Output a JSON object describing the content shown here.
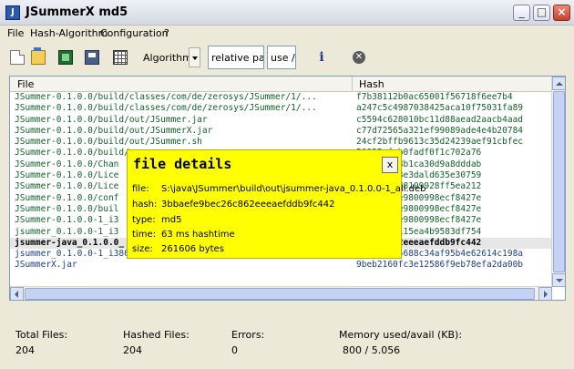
{
  "window": {
    "title": "JSummerX md5",
    "icon_letter": "J"
  },
  "menu": [
    "File",
    "Hash-Algorithm",
    "Configuration",
    "?"
  ],
  "toolbar": {
    "algorithm_label": "Algorithm",
    "path_field": "relative path",
    "use_field": "use /"
  },
  "table": {
    "headers": {
      "file": "File",
      "hash": "Hash"
    },
    "rows": [
      {
        "file": "JSummer-0.1.0.0/build/classes/com/de/zerosys/JSummer/1/...",
        "hash": "f7b38112b0ac65001f56718f6ee7b4"
      },
      {
        "file": "JSummer-0.1.0.0/build/classes/com/de/zerosys/JSummer/1/...",
        "hash": "a247c5c4987038425aca10f75031fa89"
      },
      {
        "file": "JSummer-0.1.0.0/build/out/JSummer.jar",
        "hash": "c5594c628010bc11d88aead2aacb4aad"
      },
      {
        "file": "JSummer-0.1.0.0/build/out/JSummerX.jar",
        "hash": "c77d72565a321ef99089ade4e4b20784"
      },
      {
        "file": "JSummer-0.1.0.0/build/out/JSummer.sh",
        "hash": "24cf2bffb9613c35d24239aef91cbfec"
      },
      {
        "file": "JSummer-0.1.0.0/build/",
        "hash": "50925efcb0fadf0f1c702a76"
      },
      {
        "file": "JSummer-0.1.0.0/Chan",
        "hash": "08f358518b1ca30d9a8dddab"
      },
      {
        "file": "JSummer-0.1.0.0/Lice",
        "hash": "747ac1508e3dald635e30759"
      },
      {
        "file": "JSummer-0.1.0.0/Lice",
        "hash": "824632e678109928ff5ea212"
      },
      {
        "file": "JSummer-0.1.0.0/conf",
        "hash": "8f00b204e9800998ecf8427e"
      },
      {
        "file": "JSummer-0.1.0.0/buil",
        "hash": "8f00b204e9800998ecf8427e"
      },
      {
        "file": "JSummer-0.1.0.0-1_i3",
        "hash": "8f00b204e9800998ecf8427e"
      },
      {
        "file": "jsummer_0.1.0.0-1_i3",
        "hash": "908f4224115ea4b9583df754"
      },
      {
        "file": "jsummer-java_0.1.0.0_",
        "hash": "bec26c862eeeaefddb9fc442"
      },
      {
        "file": "jsummer_0.1.0.0-1_i386.changes",
        "hash": "bcfdd9645688c34af95b4e62614c198a"
      },
      {
        "file": "JSummerX.jar",
        "hash": "9beb2160fc3e12586f9eb78efa2da00b"
      }
    ]
  },
  "popup": {
    "title": "file details",
    "close": "x",
    "rows": [
      {
        "label": "file:",
        "value": "S:\\java\\JSummer\\build\\out\\jsummer-java_0.1.0.0-1_all.deb"
      },
      {
        "label": "hash:",
        "value": "3bbaefe9bec26c862eeeaefddb9fc442"
      },
      {
        "label": "type:",
        "value": "md5"
      },
      {
        "label": "time:",
        "value": "63 ms hashtime"
      },
      {
        "label": "size:",
        "value": "261606 bytes"
      }
    ]
  },
  "status": {
    "total_label": "Total Files:",
    "total_value": "204",
    "hashed_label": "Hashed Files:",
    "hashed_value": "204",
    "errors_label": "Errors:",
    "errors_value": "0",
    "memory_label": "Memory used/avail (KB):",
    "memory_value": "800 / 5.056"
  }
}
